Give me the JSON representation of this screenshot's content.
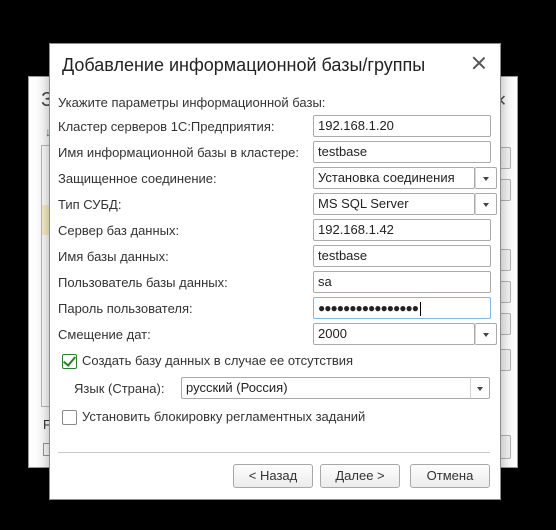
{
  "background_dialog": {
    "title_fragment": "З",
    "bottom_label_fragment": "F"
  },
  "dialog": {
    "title": "Добавление информационной базы/группы",
    "header": "Укажите параметры информационной базы:",
    "fields": {
      "cluster": {
        "label": "Кластер серверов 1С:Предприятия:",
        "value": "192.168.1.20"
      },
      "infobase_name": {
        "label": "Имя информационной базы в кластере:",
        "value": "testbase"
      },
      "secure_connection": {
        "label": "Защищенное соединение:",
        "value": "Установка соединения"
      },
      "dbms_type": {
        "label": "Тип СУБД:",
        "value": "MS SQL Server"
      },
      "db_server": {
        "label": "Сервер баз данных:",
        "value": "192.168.1.42"
      },
      "db_name": {
        "label": "Имя базы данных:",
        "value": "testbase"
      },
      "db_user": {
        "label": "Пользователь базы данных:",
        "value": "sa"
      },
      "db_password": {
        "label": "Пароль пользователя:",
        "value": "●●●●●●●●●●●●●●●●"
      },
      "date_offset": {
        "label": "Смещение дат:",
        "value": "2000"
      }
    },
    "create_db_checkbox": {
      "label": "Создать базу данных в случае ее отсутствия",
      "checked": true
    },
    "language": {
      "label": "Язык (Страна):",
      "value": "русский (Россия)"
    },
    "lock_jobs_checkbox": {
      "label": "Установить блокировку регламентных заданий",
      "checked": false
    },
    "buttons": {
      "back": "< Назад",
      "next": "Далее >",
      "cancel": "Отмена"
    }
  },
  "colors": {
    "check_accent": "#2e7d32",
    "focus_border": "#8ab4e2"
  }
}
